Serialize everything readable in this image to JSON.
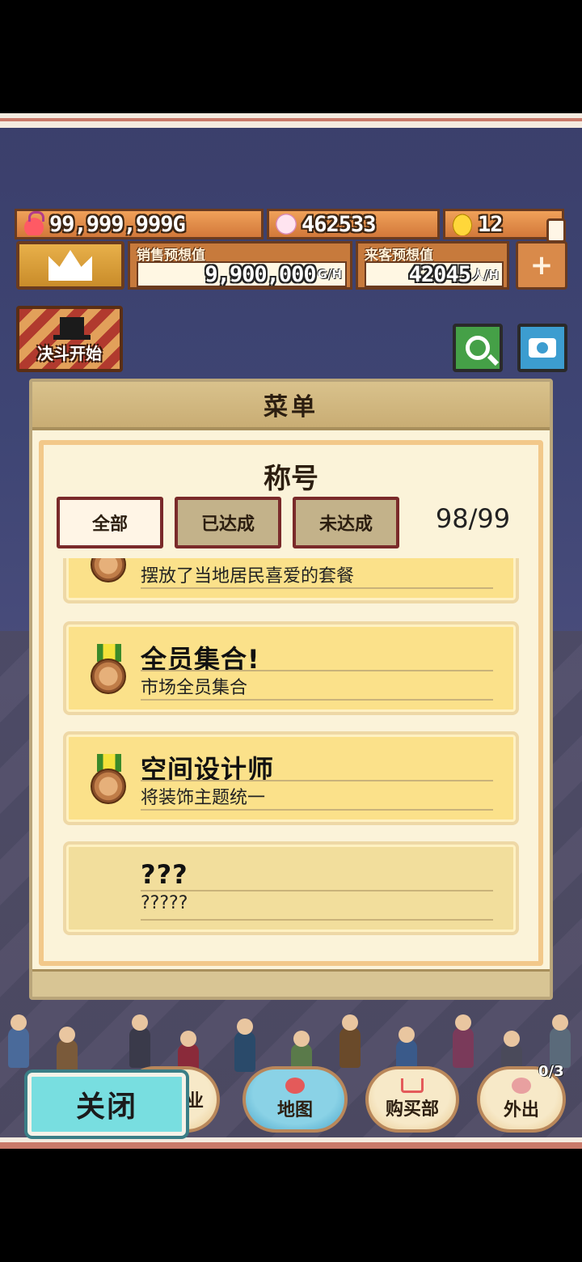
{
  "currency": {
    "gold": "99,999,999G",
    "visitors": "462533",
    "eggs": "12"
  },
  "stats": {
    "sales_label": "销售预想值",
    "sales_value": "9,900,000",
    "sales_unit": "G/H",
    "guest_label": "来客预想值",
    "guest_value": "42045",
    "guest_unit": "人/H"
  },
  "buttons": {
    "duel": "决斗开始"
  },
  "menu": {
    "header": "菜单",
    "subtitle": "称号",
    "filters": [
      "全部",
      "已达成",
      "未达成"
    ],
    "count": "98/99",
    "titles": [
      {
        "name": "",
        "desc": "摆放了当地居民喜爱的套餐"
      },
      {
        "name": "全员集合!",
        "desc": "市场全员集合"
      },
      {
        "name": "空间设计师",
        "desc": "将装饰主题统一"
      },
      {
        "name": "???",
        "desc": "?????"
      }
    ]
  },
  "nav": {
    "close": "关闭",
    "partial": "业",
    "map": "地图",
    "shop": "购买部",
    "out": "外出",
    "out_count": "0/3"
  }
}
